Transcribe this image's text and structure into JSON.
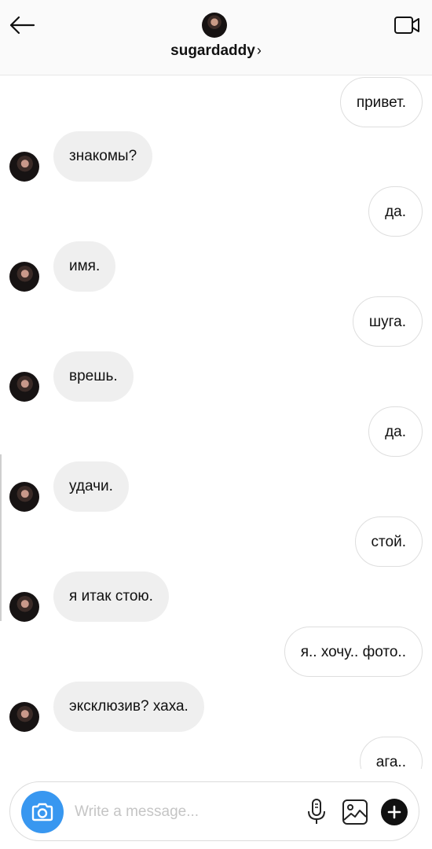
{
  "header": {
    "username": "sugardaddy",
    "chevron": "›",
    "back_icon": "back-arrow-icon",
    "video_icon": "video-call-icon"
  },
  "messages": [
    {
      "side": "out",
      "text": "привет."
    },
    {
      "side": "in",
      "text": "знакомы?"
    },
    {
      "side": "out",
      "text": "да."
    },
    {
      "side": "in",
      "text": "имя."
    },
    {
      "side": "out",
      "text": "шуга."
    },
    {
      "side": "in",
      "text": "врешь."
    },
    {
      "side": "out",
      "text": "да."
    },
    {
      "side": "in",
      "text": "удачи."
    },
    {
      "side": "out",
      "text": "стой."
    },
    {
      "side": "in",
      "text": "я итак стою."
    },
    {
      "side": "out",
      "text": "я.. хочу.. фото.."
    },
    {
      "side": "in",
      "text": "эксклюзив? хаха."
    },
    {
      "side": "out",
      "text": "ага.."
    }
  ],
  "composer": {
    "placeholder": "Write a message...",
    "camera_icon": "camera-icon",
    "mic_icon": "microphone-icon",
    "gallery_icon": "gallery-icon",
    "plus_icon": "plus-icon",
    "accent_color": "#3897f0"
  }
}
